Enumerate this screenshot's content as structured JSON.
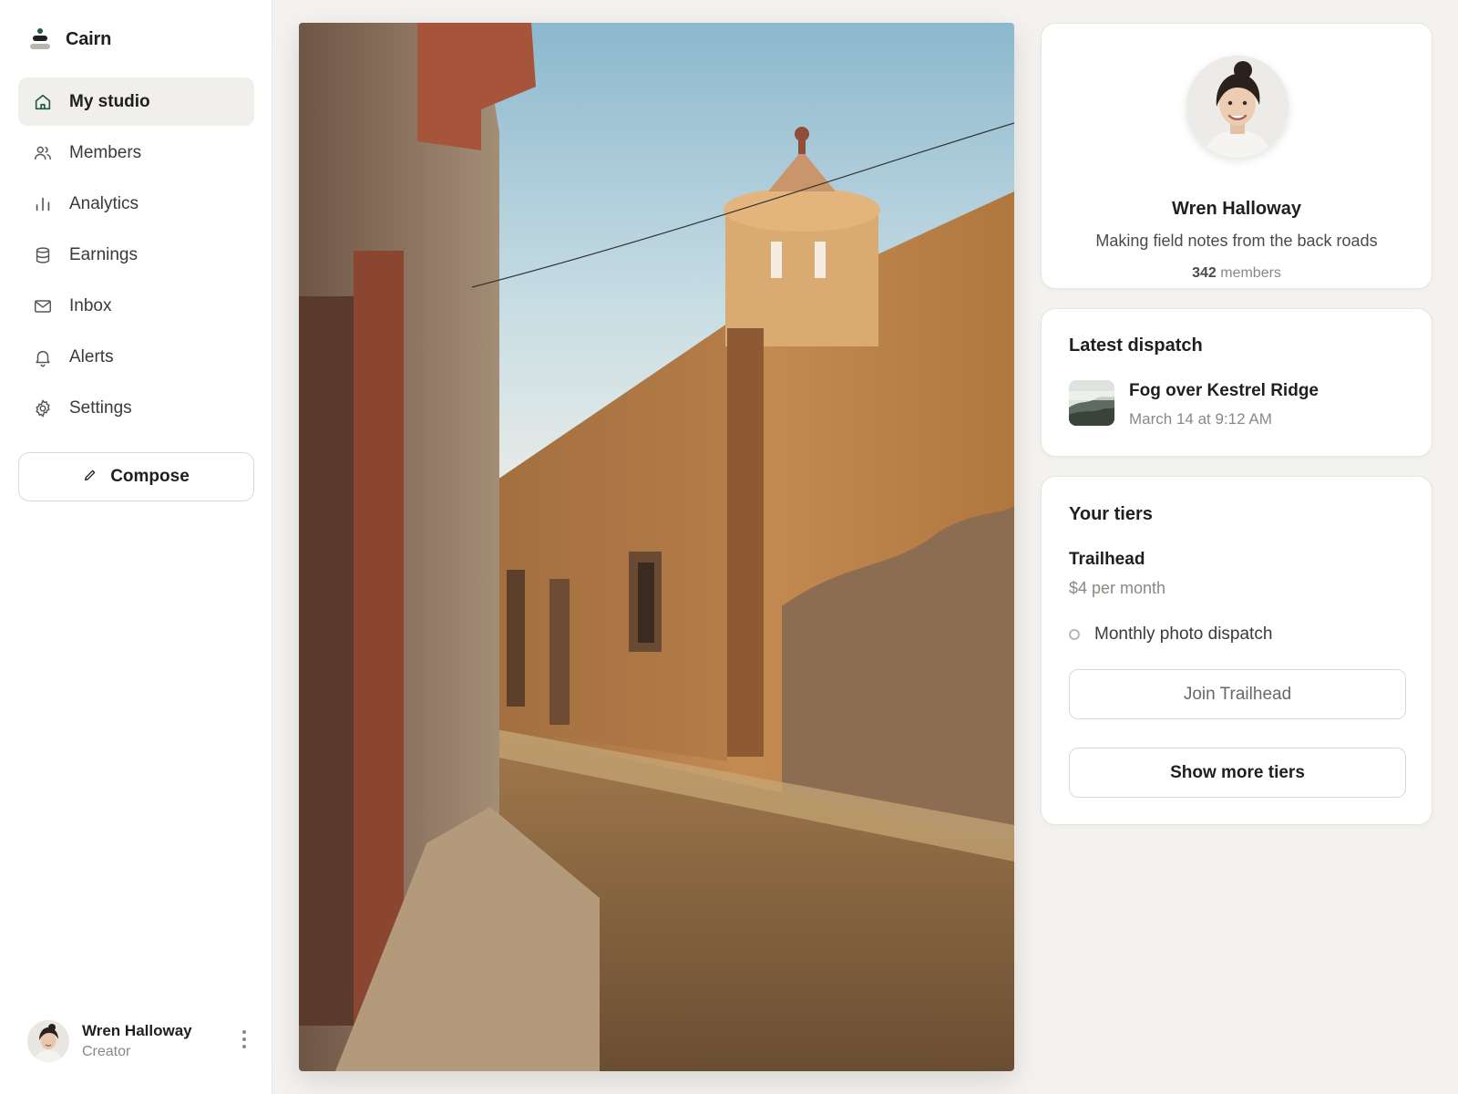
{
  "app": {
    "name": "Cairn"
  },
  "sidebar": {
    "items": [
      {
        "label": "My studio",
        "icon": "home-icon",
        "active": true
      },
      {
        "label": "Members",
        "icon": "users-icon",
        "active": false
      },
      {
        "label": "Analytics",
        "icon": "bar-chart-icon",
        "active": false
      },
      {
        "label": "Earnings",
        "icon": "coins-icon",
        "active": false
      },
      {
        "label": "Inbox",
        "icon": "mail-icon",
        "active": false
      },
      {
        "label": "Alerts",
        "icon": "bell-icon",
        "active": false
      },
      {
        "label": "Settings",
        "icon": "gear-icon",
        "active": false
      }
    ],
    "compose_label": "Compose",
    "user": {
      "name": "Wren Halloway",
      "role": "Creator"
    }
  },
  "profile": {
    "name": "Wren Halloway",
    "bio": "Making field notes from the back roads",
    "member_count": "342",
    "member_label": "members"
  },
  "dispatch": {
    "heading": "Latest dispatch",
    "title": "Fog over Kestrel Ridge",
    "date": "March 14 at 9:12 AM"
  },
  "tiers": {
    "heading": "Your tiers",
    "tier": {
      "name": "Trailhead",
      "price": "$4 per month",
      "benefit": "Monthly photo dispatch",
      "join_label": "Join Trailhead"
    },
    "more_label": "Show more tiers"
  },
  "colors": {
    "accent": "#1f5a44",
    "background": "#f4f2ef",
    "active_nav": "#f1efeb"
  }
}
